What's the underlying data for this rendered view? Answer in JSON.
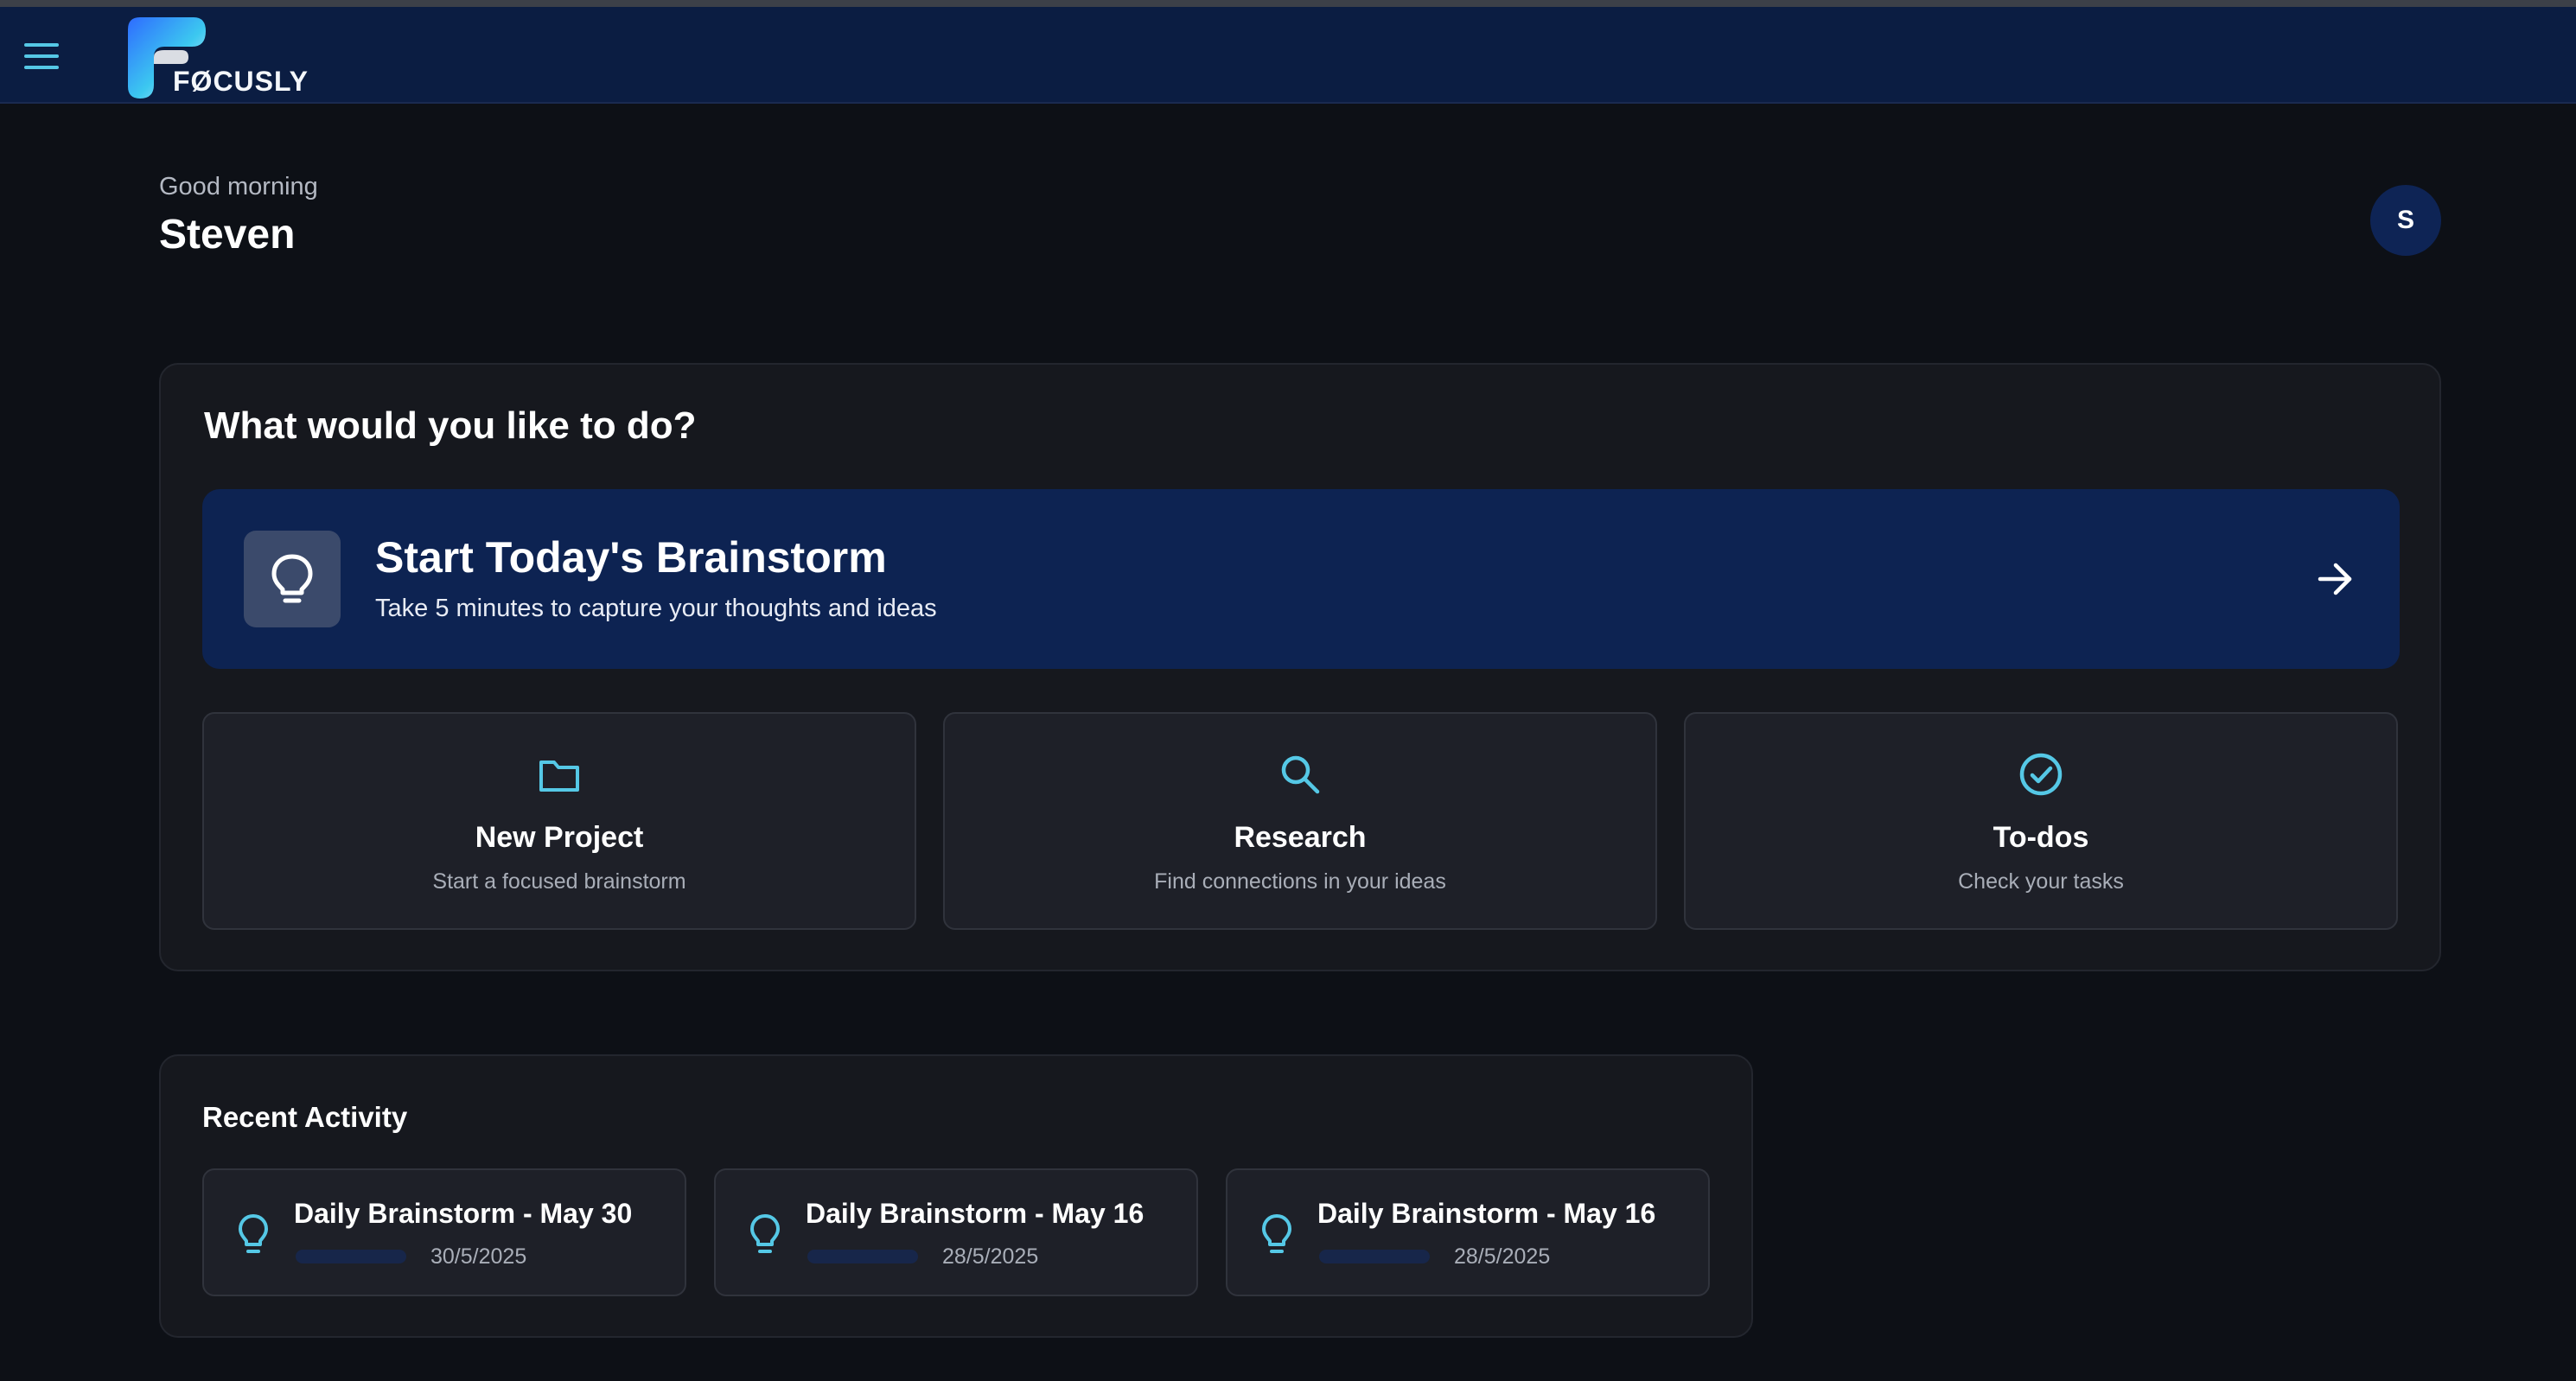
{
  "app": {
    "brand": "FØCUSLY",
    "accent_color": "#55c8e6",
    "header_color": "#0b1d42"
  },
  "greeting": {
    "salutation": "Good morning",
    "name": "Steven",
    "avatar_initial": "S"
  },
  "actions": {
    "title": "What would you like to do?",
    "hero": {
      "title": "Start Today's Brainstorm",
      "subtitle": "Take 5 minutes to capture your thoughts and ideas",
      "icon": "lightbulb-icon"
    },
    "options": [
      {
        "title": "New Project",
        "subtitle": "Start a focused brainstorm",
        "icon": "folder-icon"
      },
      {
        "title": "Research",
        "subtitle": "Find connections in your ideas",
        "icon": "search-icon"
      },
      {
        "title": "To-dos",
        "subtitle": "Check your tasks",
        "icon": "check-circle-icon"
      }
    ]
  },
  "recent": {
    "title": "Recent Activity",
    "items": [
      {
        "title": "Daily Brainstorm - May 30",
        "date": "30/5/2025",
        "icon": "lightbulb-icon"
      },
      {
        "title": "Daily Brainstorm - May 16",
        "date": "28/5/2025",
        "icon": "lightbulb-icon"
      },
      {
        "title": "Daily Brainstorm - May 16",
        "date": "28/5/2025",
        "icon": "lightbulb-icon"
      }
    ]
  }
}
